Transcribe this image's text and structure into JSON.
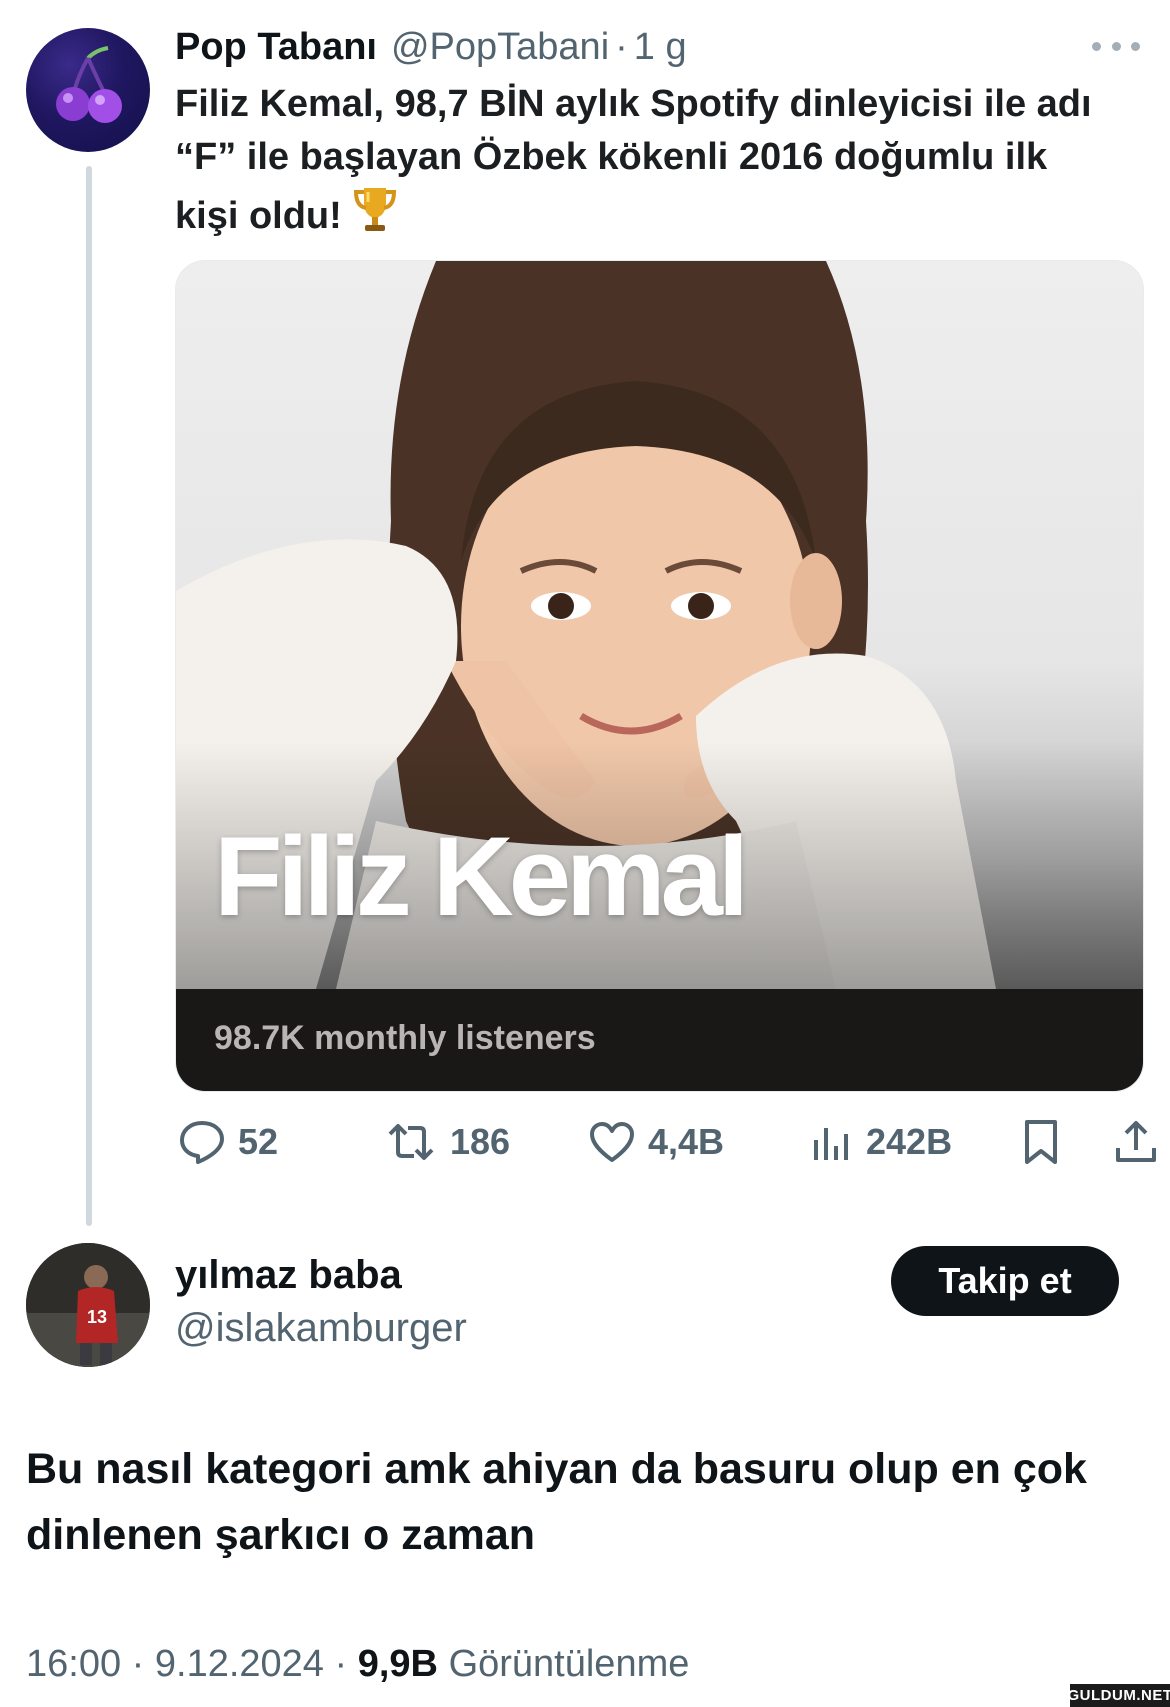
{
  "tweet": {
    "author_name": "Pop Tabanı",
    "author_handle": "@PopTabani",
    "separator": "·",
    "time": "1 g",
    "text": "Filiz Kemal, 98,7 BİN aylık Spotify dinleyicisi ile adı “F” ile başlayan Özbek kökenli 2016 doğumlu ilk kişi oldu!",
    "emoji": "trophy-icon",
    "avatar_icon": "cherries-icon",
    "media": {
      "artist_name": "Filiz Kemal",
      "listeners_text": "98.7K monthly listeners"
    },
    "actions": {
      "replies": "52",
      "reposts": "186",
      "likes": "4,4B",
      "views": "242B"
    }
  },
  "reply": {
    "author_name": "yılmaz baba",
    "author_handle": "@islakamburger",
    "follow_label": "Takip et",
    "text": "Bu nasıl kategori amk ahiyan da basuru olup en çok dinlenen şarkıcı o zaman",
    "time": "16:00",
    "separator": "·",
    "date": "9.12.2024",
    "views_count": "9,9B",
    "views_label": "Görüntülenme"
  },
  "watermark": "GULDUM.NET",
  "colors": {
    "text": "#0f1419",
    "muted": "#536471",
    "thread_line": "#cfd9de",
    "button_bg": "#0f1419",
    "listeners_bar": "#1a1817"
  }
}
